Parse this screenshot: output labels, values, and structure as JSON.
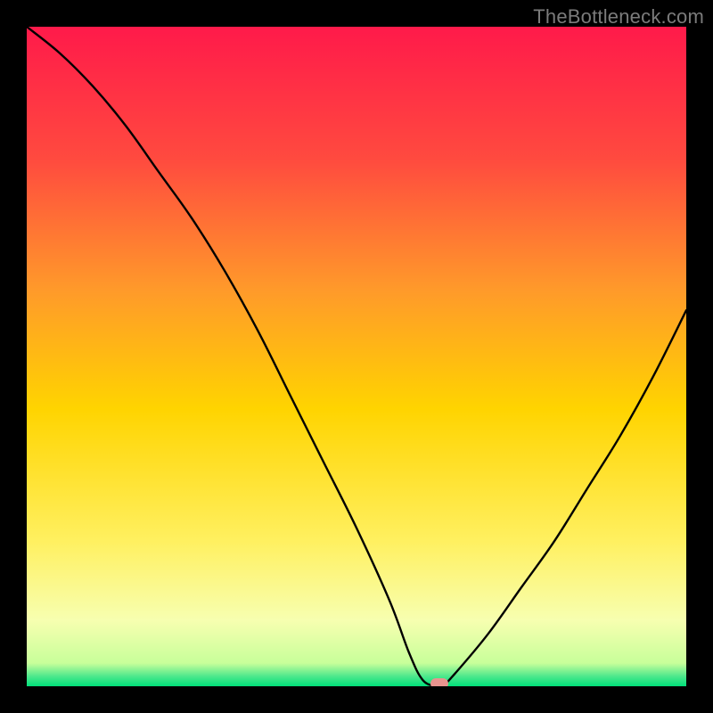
{
  "watermark": "TheBottleneck.com",
  "colors": {
    "top": "#ff1a4a",
    "upper_mid": "#ff6a3a",
    "mid": "#ffd400",
    "lower_mid": "#fff060",
    "pale": "#f7ffb0",
    "green": "#00e07a",
    "line": "#000000",
    "marker": "#e8938e",
    "background": "#000000"
  },
  "chart_data": {
    "type": "line",
    "title": "",
    "xlabel": "",
    "ylabel": "",
    "xlim": [
      0,
      100
    ],
    "ylim": [
      0,
      100
    ],
    "x": [
      0,
      5,
      10,
      15,
      20,
      25,
      30,
      35,
      40,
      45,
      50,
      55,
      58,
      60,
      62,
      63,
      65,
      70,
      75,
      80,
      85,
      90,
      95,
      100
    ],
    "y": [
      100,
      96,
      91,
      85,
      78,
      71,
      63,
      54,
      44,
      34,
      24,
      13,
      5,
      1,
      0,
      0,
      2,
      8,
      15,
      22,
      30,
      38,
      47,
      57
    ],
    "marker": {
      "x": 62.5,
      "y": 0
    },
    "gradient_stops": [
      {
        "offset": 0.0,
        "color": "#ff1a4a"
      },
      {
        "offset": 0.2,
        "color": "#ff4a3f"
      },
      {
        "offset": 0.4,
        "color": "#ff9a2a"
      },
      {
        "offset": 0.58,
        "color": "#ffd400"
      },
      {
        "offset": 0.78,
        "color": "#fff060"
      },
      {
        "offset": 0.9,
        "color": "#f7ffb0"
      },
      {
        "offset": 0.965,
        "color": "#c8ff9a"
      },
      {
        "offset": 0.985,
        "color": "#4de88c"
      },
      {
        "offset": 1.0,
        "color": "#00e07a"
      }
    ]
  }
}
